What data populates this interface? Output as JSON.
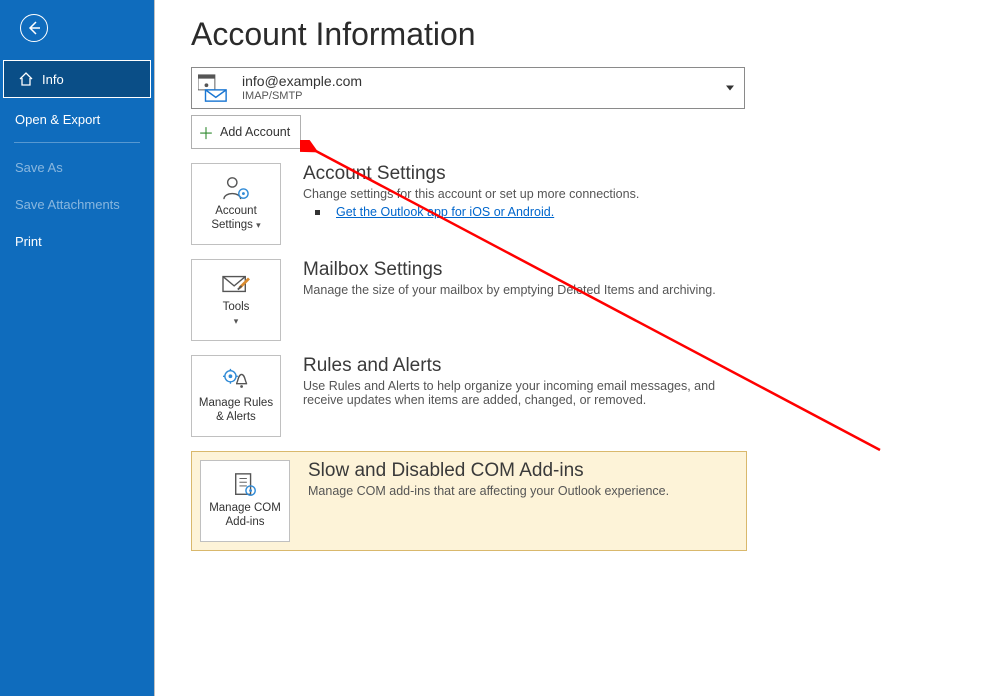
{
  "sidebar": {
    "items": [
      {
        "label": "Info",
        "selected": true,
        "icon": "home"
      },
      {
        "label": "Open & Export"
      },
      {
        "label": "Save As",
        "disabled": true
      },
      {
        "label": "Save Attachments",
        "disabled": true
      },
      {
        "label": "Print"
      }
    ]
  },
  "page": {
    "title": "Account Information"
  },
  "account": {
    "email": "info@example.com",
    "protocol": "IMAP/SMTP"
  },
  "add_account_label": "Add Account",
  "sections": {
    "account_settings": {
      "tile_label": "Account Settings",
      "title": "Account Settings",
      "desc": "Change settings for this account or set up more connections.",
      "link": "Get the Outlook app for iOS or Android."
    },
    "mailbox": {
      "tile_label": "Tools",
      "title": "Mailbox Settings",
      "desc": "Manage the size of your mailbox by emptying Deleted Items and archiving."
    },
    "rules": {
      "tile_label": "Manage Rules & Alerts",
      "title": "Rules and Alerts",
      "desc": "Use Rules and Alerts to help organize your incoming email messages, and receive updates when items are added, changed, or removed."
    },
    "addins": {
      "tile_label": "Manage COM Add-ins",
      "title": "Slow and Disabled COM Add-ins",
      "desc": "Manage COM add-ins that are affecting your Outlook experience."
    }
  },
  "colors": {
    "sidebar_bg": "#0f6cbd",
    "addins_bg": "#fdf3d8",
    "addins_border": "#d9b86c"
  }
}
